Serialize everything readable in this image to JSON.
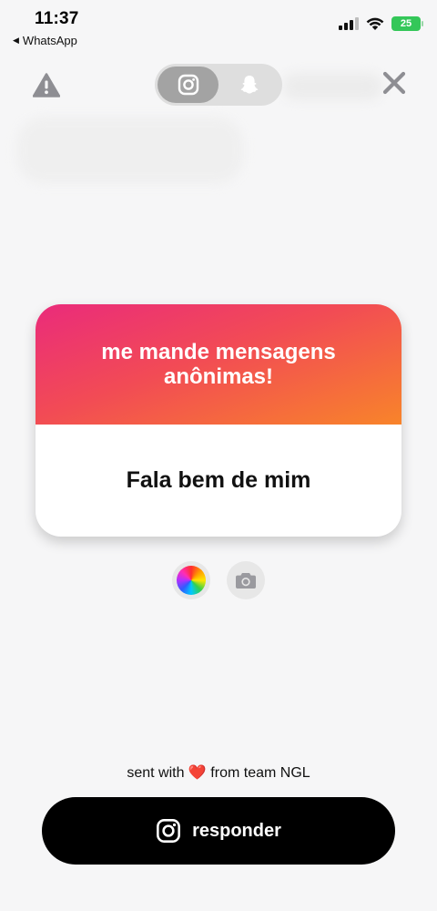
{
  "status_bar": {
    "time": "11:37",
    "back_app": "WhatsApp",
    "battery": "25"
  },
  "toolbar": {
    "warning_icon": "warning-icon",
    "instagram_icon": "instagram-icon",
    "snapchat_icon": "snapchat-ghost-icon",
    "close_icon": "close-icon",
    "active_tab": "instagram"
  },
  "card": {
    "title": "me mande mensagens anônimas!",
    "message": "Fala bem de mim",
    "gradient_colors": [
      "#ea2b7b",
      "#f24b55",
      "#f8842a"
    ]
  },
  "tools": {
    "color_icon": "color-wheel-icon",
    "camera_icon": "camera-icon"
  },
  "footer": {
    "prefix": "sent with",
    "suffix": "from team NGL",
    "heart": "❤️"
  },
  "reply_button": {
    "label": "responder",
    "icon": "instagram-icon"
  }
}
